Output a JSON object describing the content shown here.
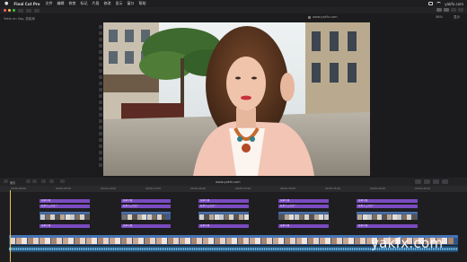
{
  "menubar": {
    "app_name": "Final Cut Pro",
    "items": [
      "文件",
      "编辑",
      "修剪",
      "标记",
      "片段",
      "修改",
      "显示",
      "窗口",
      "帮助"
    ],
    "status_right": "yakfx.com"
  },
  "browser": {
    "header": "Yakfx on Sep, 剪影库"
  },
  "viewer": {
    "title": "www.yakfx.com",
    "zoom": "58%",
    "view_menu": "显示"
  },
  "timeline": {
    "header_label": "索引",
    "title": "www.yakfx.com",
    "ruler_labels": [
      "00:00:00:00",
      "00:00:05:00",
      "00:00:10:00",
      "00:00:15:00",
      "00:00:20:00",
      "00:00:25:00",
      "00:00:30:00",
      "00:00:35:00",
      "00:00:40:00",
      "00:00:45:00"
    ],
    "title_clip_label": "基本字幕",
    "title_clip_label_2": "标准下三分之一",
    "storyline_label": "人物片段"
  },
  "watermark": "yakfx.com",
  "colors": {
    "title_clip": "#7a4bc0",
    "video_clip": "#3d5c8f",
    "audio_clip": "#1f4a6e",
    "playhead": "#e6c54a"
  }
}
